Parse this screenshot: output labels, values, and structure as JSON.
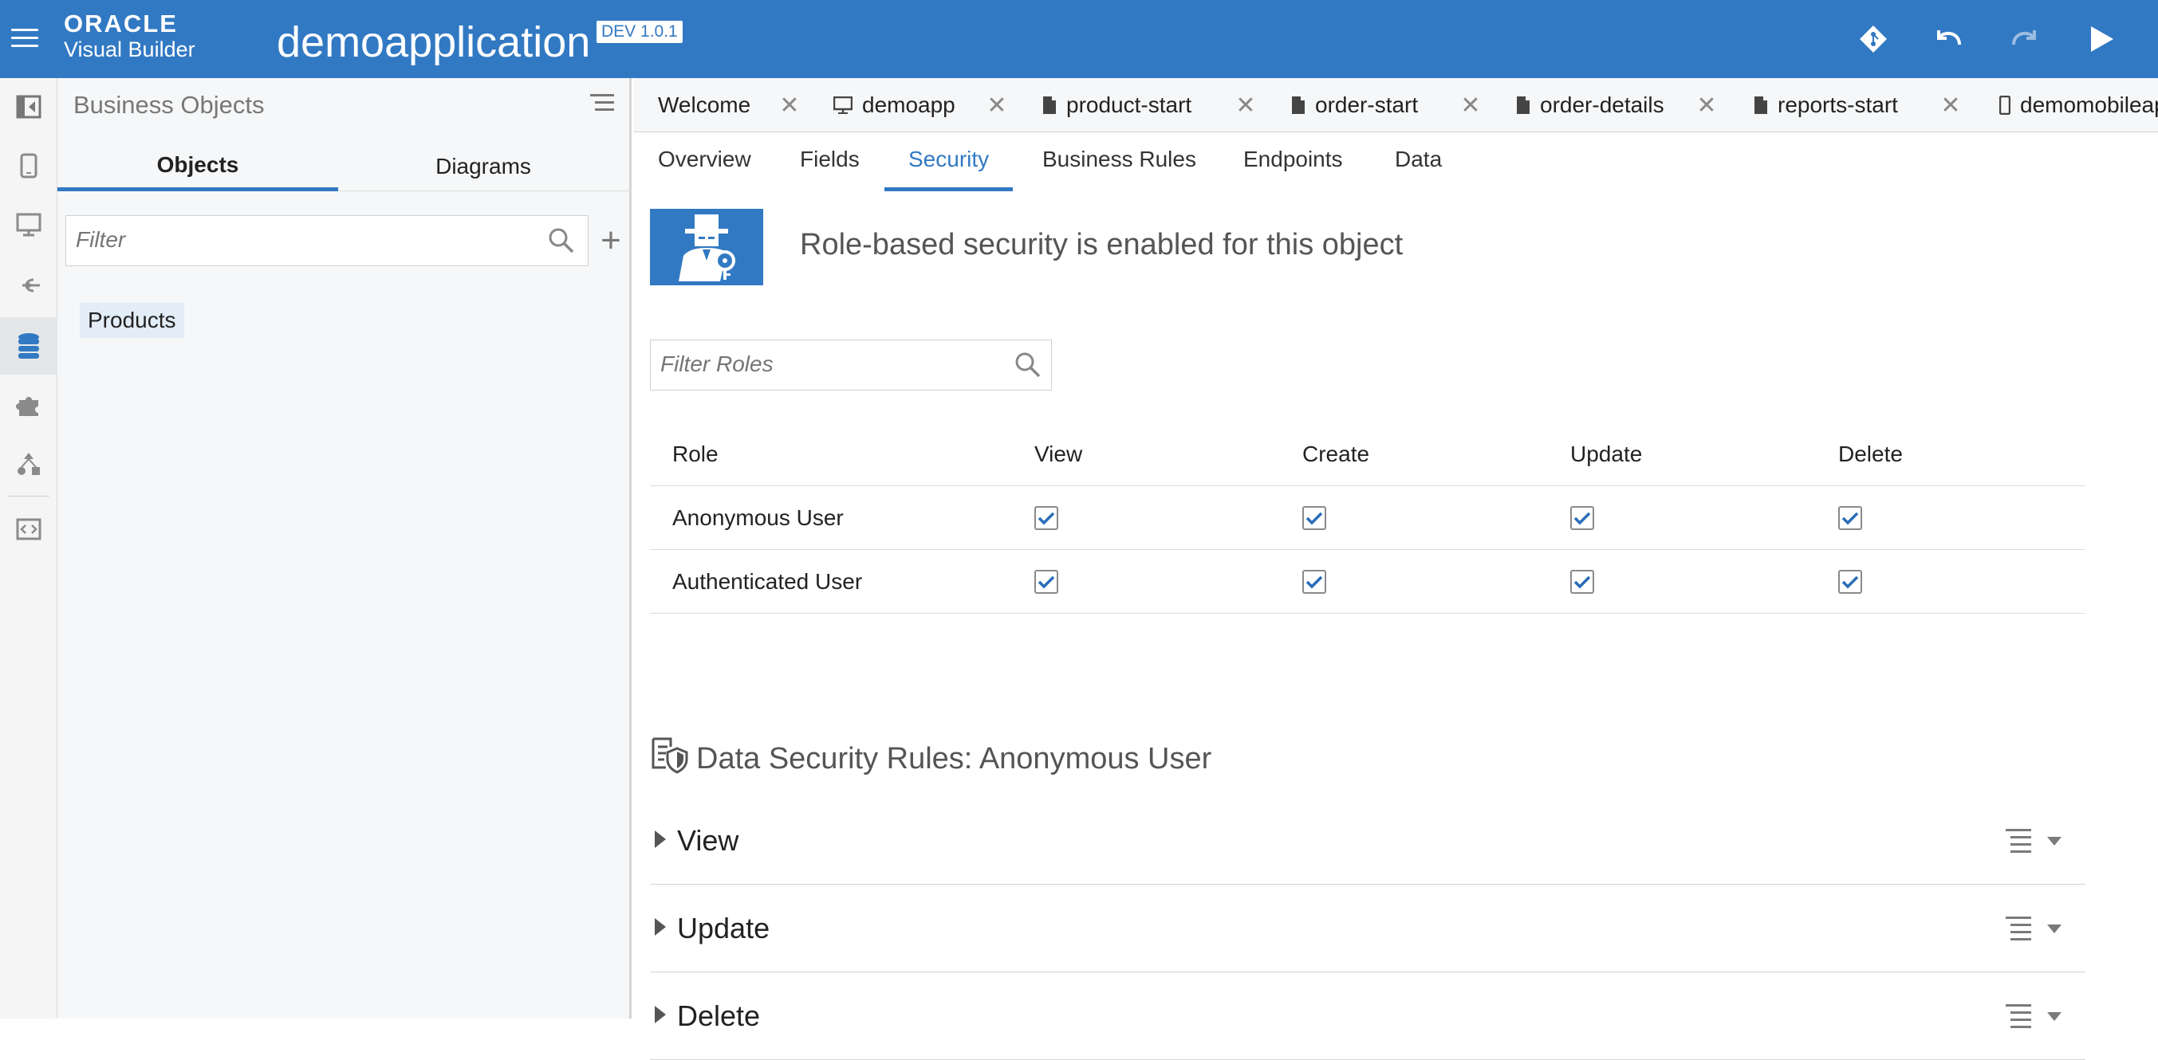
{
  "header": {
    "brand_oracle": "ORACLE",
    "brand_product": "Visual Builder",
    "app_title": "demoapplication",
    "env_badge": "DEV 1.0.1",
    "icons": [
      "menu-icon",
      "git-icon",
      "undo-icon",
      "redo-icon",
      "run-icon"
    ]
  },
  "rail": {
    "items": [
      "collapse-navigator-icon",
      "mobile-apps-icon",
      "web-apps-icon",
      "service-connections-icon",
      "business-objects-icon",
      "components-icon",
      "processes-icon",
      "source-view-icon"
    ],
    "active": "business-objects-icon"
  },
  "navigator": {
    "title": "Business Objects",
    "tabs": [
      {
        "label": "Objects",
        "active": true
      },
      {
        "label": "Diagrams",
        "active": false
      }
    ],
    "filter_placeholder": "Filter",
    "add_label": "+",
    "items": [
      {
        "label": "Products"
      }
    ]
  },
  "editor": {
    "doc_tabs": [
      {
        "label": "Welcome",
        "icon": "none"
      },
      {
        "label": "demoapp",
        "icon": "desktop-icon"
      },
      {
        "label": "product-start",
        "icon": "file-icon"
      },
      {
        "label": "order-start",
        "icon": "file-icon"
      },
      {
        "label": "order-details",
        "icon": "file-icon"
      },
      {
        "label": "reports-start",
        "icon": "file-icon"
      },
      {
        "label": "demomobileap",
        "icon": "mobile-icon"
      }
    ],
    "close_glyph": "✕",
    "sub_tabs": [
      {
        "label": "Overview"
      },
      {
        "label": "Fields"
      },
      {
        "label": "Security",
        "active": true
      },
      {
        "label": "Business Rules"
      },
      {
        "label": "Endpoints"
      },
      {
        "label": "Data"
      }
    ]
  },
  "security": {
    "banner_text": "Role-based security is enabled for this object",
    "filter_roles_placeholder": "Filter Roles",
    "columns": [
      "Role",
      "View",
      "Create",
      "Update",
      "Delete"
    ],
    "rows": [
      {
        "role": "Anonymous User",
        "view": true,
        "create": true,
        "update": true,
        "delete": true
      },
      {
        "role": "Authenticated User",
        "view": true,
        "create": true,
        "update": true,
        "delete": true
      }
    ],
    "data_rules_title": "Data Security Rules: Anonymous User",
    "rules": [
      {
        "label": "View"
      },
      {
        "label": "Update"
      },
      {
        "label": "Delete"
      }
    ]
  },
  "colors": {
    "accent": "#3279c3",
    "header_bg": "#3279c3",
    "checkbox_check": "#2a6db8"
  }
}
